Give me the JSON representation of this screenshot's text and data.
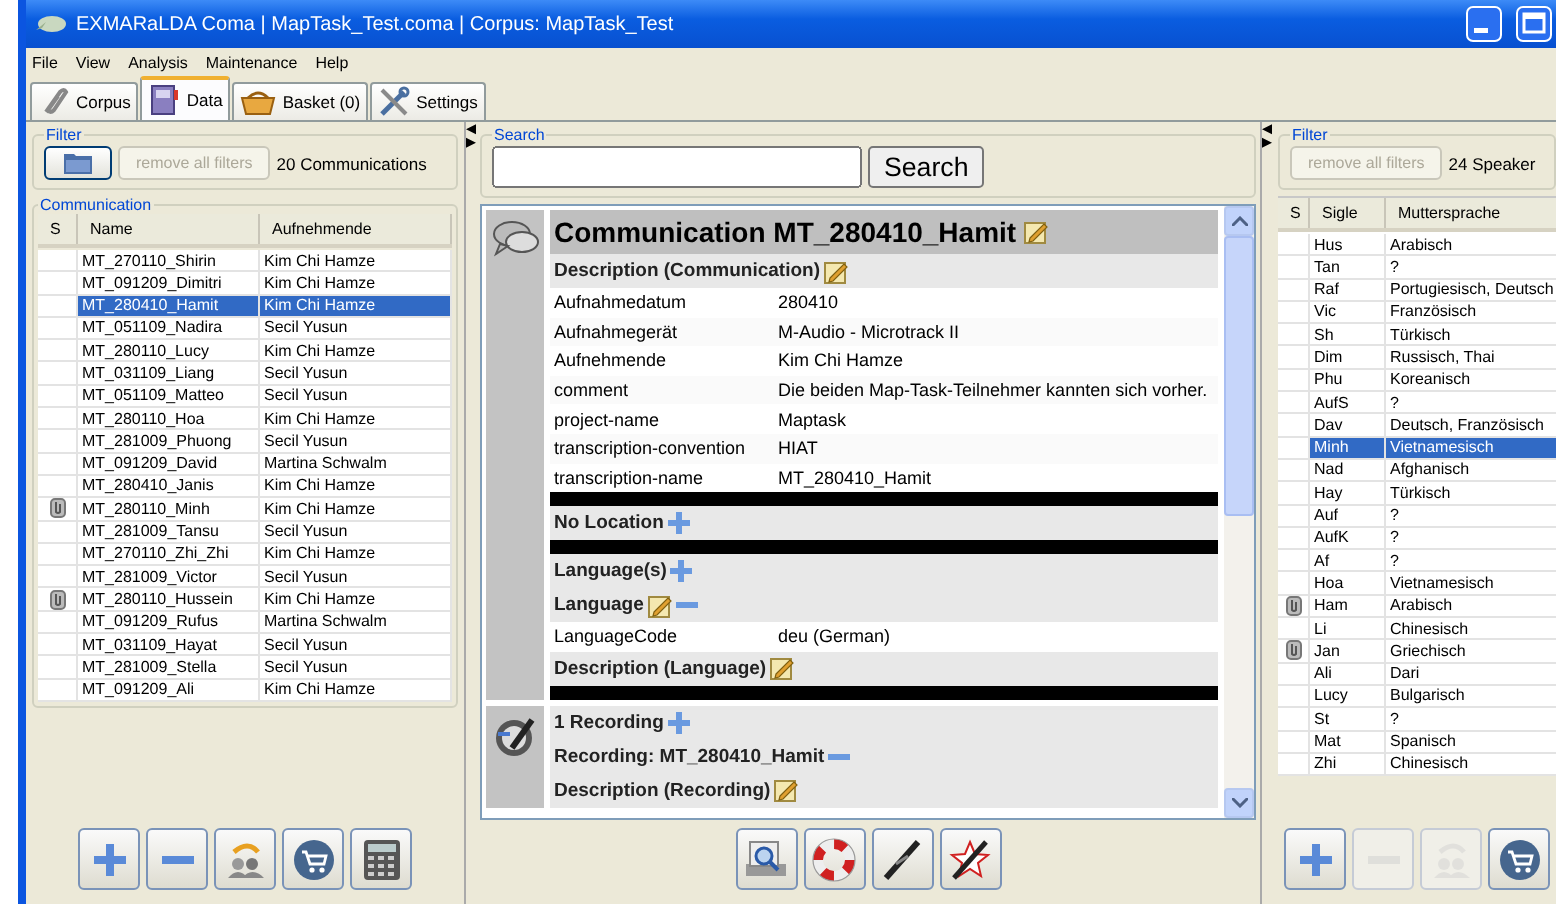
{
  "window": {
    "title": "EXMARaLDA Coma | MapTask_Test.coma | Corpus: MapTask_Test"
  },
  "menu": [
    "File",
    "View",
    "Analysis",
    "Maintenance",
    "Help"
  ],
  "tabs": [
    {
      "label": "Corpus",
      "kind": "corpus",
      "selected": false
    },
    {
      "label": "Data",
      "kind": "data",
      "selected": true
    },
    {
      "label": "Basket (0)",
      "kind": "basket",
      "selected": false
    },
    {
      "label": "Settings",
      "kind": "settings",
      "selected": false
    }
  ],
  "left": {
    "filter": {
      "title": "Filter",
      "remove_button": {
        "label": "remove all filters",
        "disabled": true
      },
      "count": "20 Communications"
    },
    "table": {
      "title": "Communication",
      "columns": [
        "S",
        "Name",
        "Aufnehmende"
      ],
      "rows": [
        {
          "name": "MT_270110_Shirin",
          "recorder": "Kim Chi Hamze",
          "has_file": false,
          "selected": false
        },
        {
          "name": "MT_091209_Dimitri",
          "recorder": "Kim Chi Hamze",
          "has_file": false,
          "selected": false
        },
        {
          "name": "MT_280410_Hamit",
          "recorder": "Kim Chi Hamze",
          "has_file": false,
          "selected": true
        },
        {
          "name": "MT_051109_Nadira",
          "recorder": "Secil Yusun",
          "has_file": false,
          "selected": false
        },
        {
          "name": "MT_280110_Lucy",
          "recorder": "Kim Chi Hamze",
          "has_file": false,
          "selected": false
        },
        {
          "name": "MT_031109_Liang",
          "recorder": "Secil Yusun",
          "has_file": false,
          "selected": false
        },
        {
          "name": "MT_051109_Matteo",
          "recorder": "Secil Yusun",
          "has_file": false,
          "selected": false
        },
        {
          "name": "MT_280110_Hoa",
          "recorder": "Kim Chi Hamze",
          "has_file": false,
          "selected": false
        },
        {
          "name": "MT_281009_Phuong",
          "recorder": "Secil Yusun",
          "has_file": false,
          "selected": false
        },
        {
          "name": "MT_091209_David",
          "recorder": "Martina Schwalm",
          "has_file": false,
          "selected": false
        },
        {
          "name": "MT_280410_Janis",
          "recorder": "Kim Chi Hamze",
          "has_file": false,
          "selected": false
        },
        {
          "name": "MT_280110_Minh",
          "recorder": "Kim Chi Hamze",
          "has_file": true,
          "selected": false
        },
        {
          "name": "MT_281009_Tansu",
          "recorder": "Secil Yusun",
          "has_file": false,
          "selected": false
        },
        {
          "name": "MT_270110_Zhi_Zhi",
          "recorder": "Kim Chi Hamze",
          "has_file": false,
          "selected": false
        },
        {
          "name": "MT_281009_Victor",
          "recorder": "Secil Yusun",
          "has_file": false,
          "selected": false
        },
        {
          "name": "MT_280110_Hussein",
          "recorder": "Kim Chi Hamze",
          "has_file": true,
          "selected": false
        },
        {
          "name": "MT_091209_Rufus",
          "recorder": "Martina Schwalm",
          "has_file": false,
          "selected": false
        },
        {
          "name": "MT_031109_Hayat",
          "recorder": "Secil Yusun",
          "has_file": false,
          "selected": false
        },
        {
          "name": "MT_281009_Stella",
          "recorder": "Secil Yusun",
          "has_file": false,
          "selected": false
        },
        {
          "name": "MT_091209_Ali",
          "recorder": "Kim Chi Hamze",
          "has_file": false,
          "selected": false
        }
      ]
    },
    "buttons": [
      {
        "kind": "add",
        "disabled": false
      },
      {
        "kind": "remove",
        "disabled": false
      },
      {
        "kind": "assign",
        "disabled": false
      },
      {
        "kind": "basket",
        "disabled": false
      },
      {
        "kind": "calculator",
        "disabled": false
      }
    ]
  },
  "center": {
    "search": {
      "title": "Search",
      "button": "Search"
    },
    "groups": [
      {
        "kind": "communication",
        "blocks": [
          {
            "kind": "title",
            "text": "Communication MT_280410_Hamit",
            "edit": true
          },
          {
            "kind": "section",
            "text": "Description (Communication)",
            "edit": true,
            "add": false,
            "remove": false
          },
          {
            "kind": "field",
            "label": "Aufnahmedatum",
            "value": "280410"
          },
          {
            "kind": "field",
            "label": "Aufnahmegerät",
            "value": "M-Audio - Microtrack II"
          },
          {
            "kind": "field",
            "label": "Aufnehmende",
            "value": "Kim Chi Hamze"
          },
          {
            "kind": "field",
            "label": "comment",
            "value": "Die beiden Map-Task-Teilnehmer kannten sich vorher."
          },
          {
            "kind": "field",
            "label": "project-name",
            "value": "Maptask"
          },
          {
            "kind": "field",
            "label": "transcription-convention",
            "value": "HIAT"
          },
          {
            "kind": "field",
            "label": "transcription-name",
            "value": "MT_280410_Hamit"
          },
          {
            "kind": "divider"
          },
          {
            "kind": "section",
            "text": "No Location",
            "edit": false,
            "add": true,
            "remove": false
          },
          {
            "kind": "divider"
          },
          {
            "kind": "section",
            "text": "Language(s)",
            "edit": false,
            "add": true,
            "remove": false
          },
          {
            "kind": "section",
            "text": "Language",
            "edit": true,
            "add": false,
            "remove": true
          },
          {
            "kind": "field",
            "label": "LanguageCode",
            "value": "deu (German)"
          },
          {
            "kind": "section",
            "text": "Description (Language)",
            "edit": true,
            "add": false,
            "remove": false
          },
          {
            "kind": "divider"
          }
        ]
      },
      {
        "kind": "recording",
        "blocks": [
          {
            "kind": "section",
            "text": "1 Recording",
            "edit": false,
            "add": true,
            "remove": false
          },
          {
            "kind": "section",
            "text": "Recording: MT_280410_Hamit",
            "edit": false,
            "add": false,
            "remove": true
          },
          {
            "kind": "section",
            "text": "Description (Recording)",
            "edit": true,
            "add": false,
            "remove": false
          }
        ]
      }
    ],
    "buttons": [
      {
        "kind": "preview",
        "disabled": false
      },
      {
        "kind": "help",
        "disabled": false
      },
      {
        "kind": "link",
        "disabled": false
      },
      {
        "kind": "unlink",
        "disabled": false
      }
    ]
  },
  "right": {
    "filter": {
      "title": "Filter",
      "remove_button": {
        "label": "remove all filters",
        "disabled": true
      },
      "count": "24 Speaker"
    },
    "table": {
      "columns": [
        "S",
        "Sigle",
        "Muttersprache"
      ],
      "rows": [
        {
          "sigle": "Hus",
          "language": "Arabisch",
          "has_file": false,
          "selected": false
        },
        {
          "sigle": "Tan",
          "language": "?",
          "has_file": false,
          "selected": false
        },
        {
          "sigle": "Raf",
          "language": "Portugiesisch, Deutsch",
          "has_file": false,
          "selected": false
        },
        {
          "sigle": "Vic",
          "language": "Französisch",
          "has_file": false,
          "selected": false
        },
        {
          "sigle": "Sh",
          "language": "Türkisch",
          "has_file": false,
          "selected": false
        },
        {
          "sigle": "Dim",
          "language": "Russisch, Thai",
          "has_file": false,
          "selected": false
        },
        {
          "sigle": "Phu",
          "language": "Koreanisch",
          "has_file": false,
          "selected": false
        },
        {
          "sigle": "AufS",
          "language": "?",
          "has_file": false,
          "selected": false
        },
        {
          "sigle": "Dav",
          "language": "Deutsch, Französisch",
          "has_file": false,
          "selected": false
        },
        {
          "sigle": "Minh",
          "language": "Vietnamesisch",
          "has_file": false,
          "selected": true
        },
        {
          "sigle": "Nad",
          "language": "Afghanisch",
          "has_file": false,
          "selected": false
        },
        {
          "sigle": "Hay",
          "language": "Türkisch",
          "has_file": false,
          "selected": false
        },
        {
          "sigle": "Auf",
          "language": "?",
          "has_file": false,
          "selected": false
        },
        {
          "sigle": "AufK",
          "language": "?",
          "has_file": false,
          "selected": false
        },
        {
          "sigle": "Af",
          "language": "?",
          "has_file": false,
          "selected": false
        },
        {
          "sigle": "Hoa",
          "language": "Vietnamesisch",
          "has_file": false,
          "selected": false
        },
        {
          "sigle": "Ham",
          "language": "Arabisch",
          "has_file": true,
          "selected": false
        },
        {
          "sigle": "Li",
          "language": "Chinesisch",
          "has_file": false,
          "selected": false
        },
        {
          "sigle": "Jan",
          "language": "Griechisch",
          "has_file": true,
          "selected": false
        },
        {
          "sigle": "Ali",
          "language": "Dari",
          "has_file": false,
          "selected": false
        },
        {
          "sigle": "Lucy",
          "language": "Bulgarisch",
          "has_file": false,
          "selected": false
        },
        {
          "sigle": "St",
          "language": "?",
          "has_file": false,
          "selected": false
        },
        {
          "sigle": "Mat",
          "language": "Spanisch",
          "has_file": false,
          "selected": false
        },
        {
          "sigle": "Zhi",
          "language": "Chinesisch",
          "has_file": false,
          "selected": false
        }
      ]
    },
    "buttons": [
      {
        "kind": "add",
        "disabled": false
      },
      {
        "kind": "remove",
        "disabled": true
      },
      {
        "kind": "assign",
        "disabled": true
      },
      {
        "kind": "basket",
        "disabled": false
      }
    ]
  }
}
